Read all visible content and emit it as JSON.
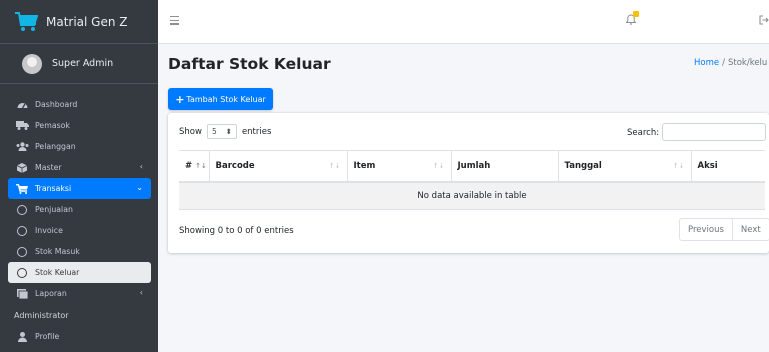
{
  "brand": {
    "name": "Matrial Gen Z"
  },
  "user": {
    "name": "Super Admin"
  },
  "sidebar": {
    "items": [
      {
        "label": "Dashboard"
      },
      {
        "label": "Pemasok"
      },
      {
        "label": "Pelanggan"
      },
      {
        "label": "Master"
      },
      {
        "label": "Transaksi"
      },
      {
        "label": "Penjualan"
      },
      {
        "label": "Invoice"
      },
      {
        "label": "Stok Masuk"
      },
      {
        "label": "Stok Keluar"
      },
      {
        "label": "Laporan"
      }
    ],
    "header": "Administrator",
    "profile": "Profile"
  },
  "page": {
    "title": "Daftar Stok Keluar",
    "breadcrumb_home": "Home",
    "breadcrumb_sep": "/",
    "breadcrumb_current": "Stok/kelu"
  },
  "actions": {
    "add_label": "Tambah Stok Keluar"
  },
  "table": {
    "show_label": "Show",
    "entries_value": "5",
    "entries_label": "entries",
    "search_label": "Search:",
    "search_value": "",
    "columns": [
      "#",
      "Barcode",
      "Item",
      "Jumlah",
      "Tanggal",
      "Aksi"
    ],
    "empty_message": "No data available in table",
    "info": "Showing 0 to 0 of 0 entries",
    "prev_label": "Previous",
    "next_label": "Next"
  },
  "colors": {
    "accent": "#007bff",
    "sidebar_bg": "#343a40",
    "badge": "#ffc107"
  }
}
